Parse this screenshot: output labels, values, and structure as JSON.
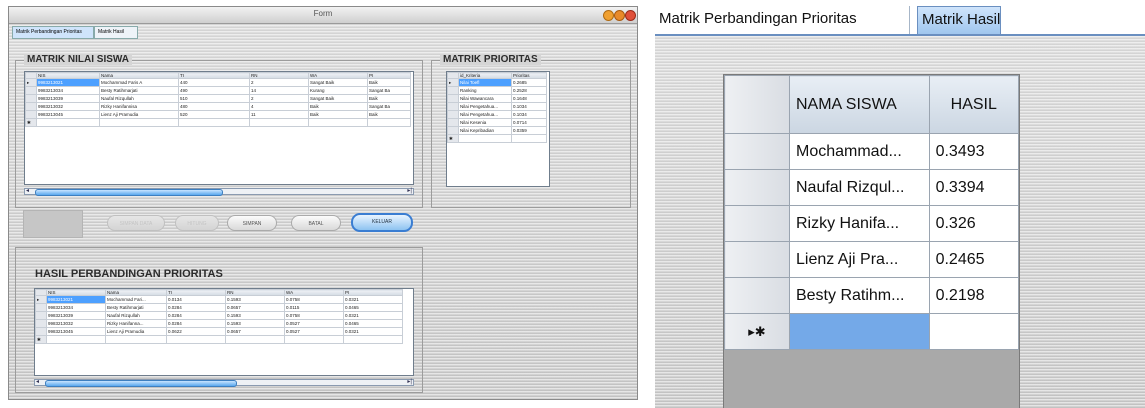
{
  "left_window": {
    "title": "Form",
    "tabs": [
      "Matrik Perbandingan Prioritas",
      "Matrik Hasil"
    ],
    "nilai_group_title": "MATRIK NILAI SISWA",
    "nilai_headers": [
      "NIS",
      "Nama",
      "TI",
      "RN",
      "WA",
      "PI"
    ],
    "nilai_rows": [
      [
        "9983213021",
        "Mochammad Faris A",
        "440",
        "2",
        "Sangat Baik",
        "Baik"
      ],
      [
        "9983213034",
        "Besty Ratihmarjati",
        "490",
        "14",
        "Kurang",
        "Sangat Ba"
      ],
      [
        "9983213039",
        "Naufal Rizqullah",
        "510",
        "2",
        "Sangat Baik",
        "Baik"
      ],
      [
        "9983213032",
        "Rizky Hanifannisa",
        "480",
        "4",
        "Baik",
        "Sangat Ba"
      ],
      [
        "9983213045",
        "Lienz Aji Pramudia",
        "520",
        "11",
        "Baik",
        "Baik"
      ]
    ],
    "prioritas_group_title": "MATRIK PRIORITAS",
    "prioritas_headers": [
      "id_Kriteria",
      "Prioritas"
    ],
    "prioritas_rows": [
      [
        "Nilai Toefl",
        "0.2685"
      ],
      [
        "Ranking",
        "0.2528"
      ],
      [
        "Nilai Wawancara",
        "0.1648"
      ],
      [
        "Nilai Pengetahua...",
        "0.1034"
      ],
      [
        "Nilai Pengetahua...",
        "0.1034"
      ],
      [
        "Nilai Kesenia",
        "0.0714"
      ],
      [
        "Nilai Kepribadian",
        "0.0359"
      ]
    ],
    "buttons": {
      "b1": "",
      "b2": "SIMPAN DATA",
      "b3": "HITUNG",
      "simpan": "SIMPAN",
      "batal": "BATAL",
      "keluar": "KELUAR"
    },
    "hasil_group_title": "HASIL PERBANDINGAN PRIORITAS",
    "hasil_headers": [
      "NIS",
      "Nama",
      "TI",
      "RN",
      "WA",
      "PI"
    ],
    "hasil_rows": [
      [
        "9983213021",
        "Mochammad Fari...",
        "0.0134",
        "0.1593",
        "0.0758",
        "0.0321"
      ],
      [
        "9983213034",
        "Besty Ratihmarjati",
        "0.0284",
        "0.0657",
        "0.0115",
        "0.0465"
      ],
      [
        "9983213039",
        "Naufal Rizqullah",
        "0.0284",
        "0.1593",
        "0.0758",
        "0.0321"
      ],
      [
        "9983213032",
        "Rizky Hanifanna...",
        "0.0284",
        "0.1593",
        "0.0527",
        "0.0465"
      ],
      [
        "9983213045",
        "Lienz Aji Pramudia",
        "0.0622",
        "0.0657",
        "0.0527",
        "0.0321"
      ]
    ],
    "scroll_left_arrow": "◂",
    "scroll_right_arrow": "▸|"
  },
  "right_window": {
    "tabs": [
      "Matrik Perbandingan Prioritas",
      "Matrik Hasil"
    ],
    "headers": [
      "NAMA SISWA",
      "HASIL"
    ],
    "rows": [
      [
        "Mochammad...",
        "0.3493"
      ],
      [
        "Naufal Rizqul...",
        "0.3394"
      ],
      [
        "Rizky Hanifa...",
        "0.326"
      ],
      [
        "Lienz Aji Pra...",
        "0.2465"
      ],
      [
        "Besty Ratihm...",
        "0.2198"
      ]
    ],
    "new_row_marker": "▸✱"
  },
  "colors": {
    "selection_blue": "#4da0ff",
    "tab_active": "#9fc6ee",
    "panel_gray": "#d5d5d5"
  }
}
